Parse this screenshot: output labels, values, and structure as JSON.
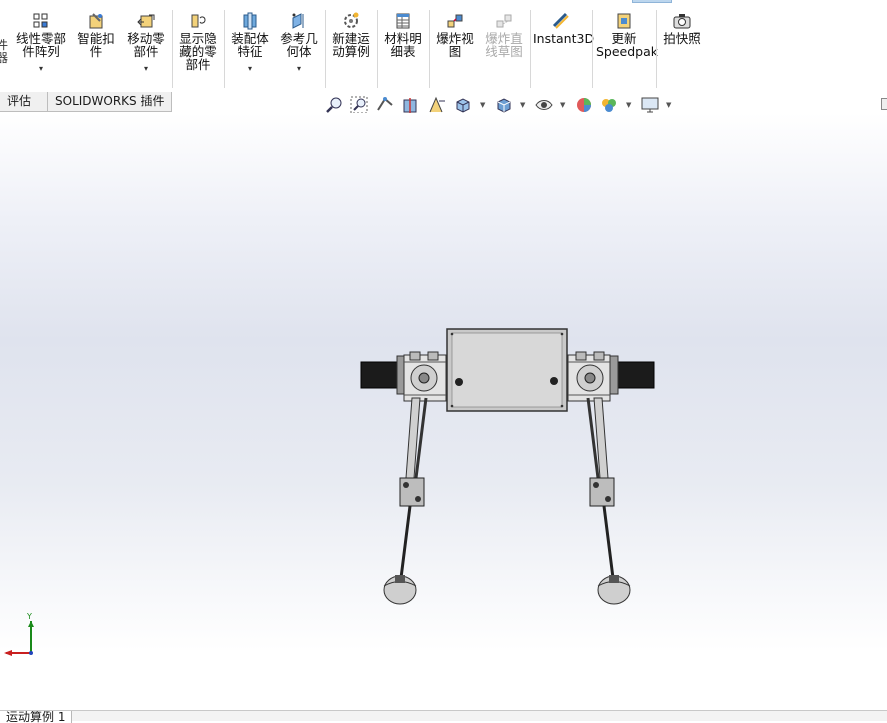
{
  "ribbon": {
    "cut_left_label": "件\n器",
    "items": [
      {
        "label": "线性零部\n件阵列",
        "icon": "linear-pattern-icon",
        "dropdown": true
      },
      {
        "label": "智能扣\n件",
        "icon": "smart-fastener-icon",
        "dropdown": false
      },
      {
        "label": "移动零\n部件",
        "icon": "move-component-icon",
        "dropdown": true
      },
      {
        "label": "显示隐\n藏的零\n部件",
        "icon": "show-hidden-icon",
        "dropdown": false
      },
      {
        "label": "装配体\n特征",
        "icon": "assembly-feature-icon",
        "dropdown": true
      },
      {
        "label": "参考几\n何体",
        "icon": "reference-geometry-icon",
        "dropdown": true
      },
      {
        "label": "新建运\n动算例",
        "icon": "new-motion-study-icon",
        "dropdown": false
      },
      {
        "label": "材料明\n细表",
        "icon": "bill-of-materials-icon",
        "dropdown": false
      },
      {
        "label": "爆炸视\n图",
        "icon": "exploded-view-icon",
        "dropdown": false
      },
      {
        "label": "爆炸直\n线草图",
        "icon": "explode-line-sketch-icon",
        "dropdown": false,
        "disabled": true
      },
      {
        "label": "Instant3D",
        "icon": "instant3d-icon",
        "dropdown": false
      },
      {
        "label": "更新\nSpeedpak",
        "icon": "speedpak-icon",
        "dropdown": false
      },
      {
        "label": "拍快照",
        "icon": "snapshot-icon",
        "dropdown": false
      }
    ]
  },
  "tabs": [
    {
      "label": "评估"
    },
    {
      "label": "SOLIDWORKS 插件"
    }
  ],
  "heads_up_toolbar": [
    "zoom-to-fit-icon",
    "zoom-to-area-icon",
    "previous-view-icon",
    "section-view-icon",
    "dynamic-annotation-icon",
    "view-orientation-icon",
    "display-style-icon",
    "hide-show-items-icon",
    "edit-appearance-icon",
    "apply-scene-icon",
    "view-settings-icon"
  ],
  "triad": {
    "y_label": "Y"
  },
  "bottom": {
    "motion_study_tab": "运动算例 1"
  },
  "colors": {
    "accent": "#1f6fc0",
    "viewport_top": "#ffffff",
    "viewport_mid": "#dfe3ee"
  }
}
